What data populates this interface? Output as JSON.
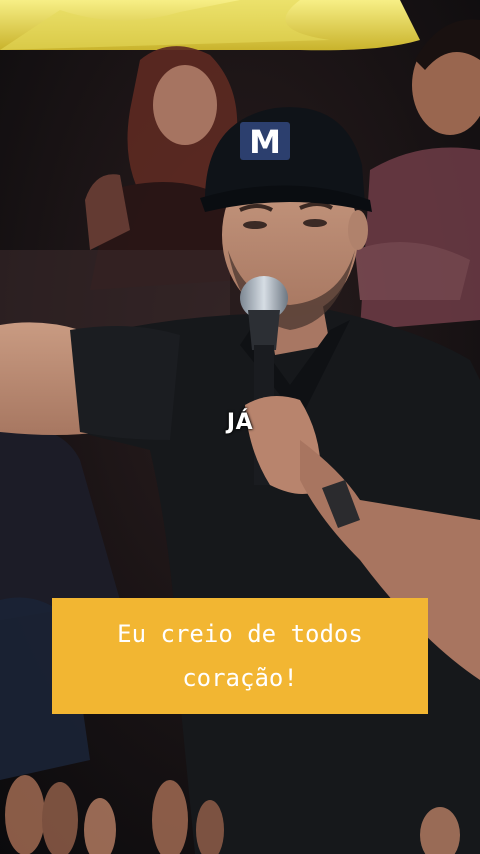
{
  "video": {
    "subtitle_word": "JÁ",
    "caption": {
      "line1": "Eu creio de todos",
      "line2": "coração!"
    },
    "cap_logo": "M",
    "colors": {
      "caption_bg": "#f2b632",
      "caption_text": "#ffffff",
      "shirt": "#16181b",
      "cap": "#0f1318"
    }
  }
}
